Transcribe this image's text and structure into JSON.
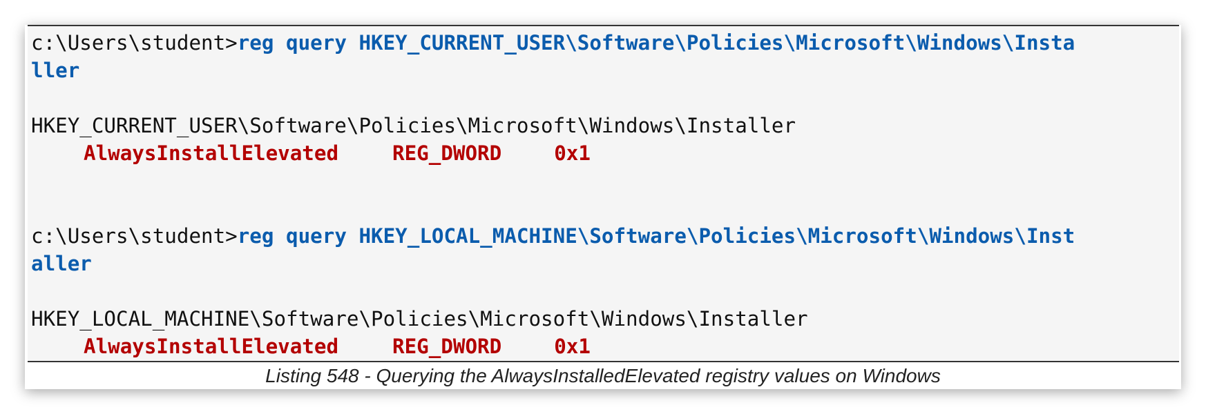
{
  "listing": {
    "block1": {
      "prompt": "c:\\Users\\student>",
      "command_line1": "reg query HKEY_CURRENT_USER\\Software\\Policies\\Microsoft\\Windows\\Insta",
      "command_line2": "ller",
      "key_path": "HKEY_CURRENT_USER\\Software\\Policies\\Microsoft\\Windows\\Installer",
      "value_name": "AlwaysInstallElevated",
      "value_type": "REG_DWORD",
      "value_data": "0x1"
    },
    "block2": {
      "prompt": "c:\\Users\\student>",
      "command_line1": "reg query HKEY_LOCAL_MACHINE\\Software\\Policies\\Microsoft\\Windows\\Inst",
      "command_line2": "aller",
      "key_path": "HKEY_LOCAL_MACHINE\\Software\\Policies\\Microsoft\\Windows\\Installer",
      "value_name": "AlwaysInstallElevated",
      "value_type": "REG_DWORD",
      "value_data": "0x1"
    }
  },
  "caption": "Listing 548 - Querying the AlwaysInstalledElevated registry values on Windows",
  "colors": {
    "command": "#0b5cad",
    "value": "#b30000",
    "background": "#f5f5f5"
  }
}
